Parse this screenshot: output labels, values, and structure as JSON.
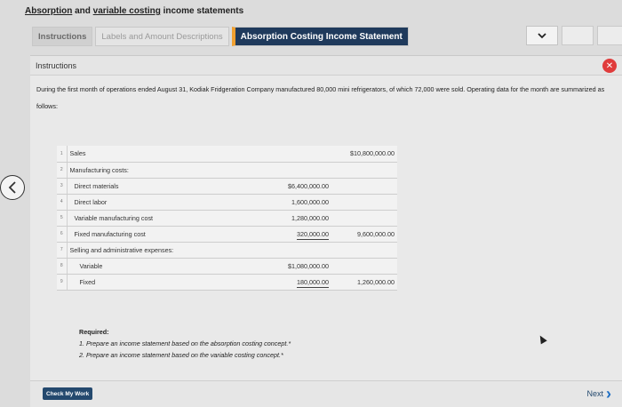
{
  "page": {
    "title_part1": "Absorption",
    "title_part2": " and ",
    "title_part3": "variable costing",
    "title_part4": " income statements"
  },
  "tabs": [
    {
      "label": "Instructions"
    },
    {
      "label": "Labels and Amount Descriptions"
    },
    {
      "label": "Absorption Costing Income Statement"
    }
  ],
  "icons": {
    "chevron": "chevron-down-icon",
    "menu": "menu-icon",
    "close": "close-icon",
    "back": "chevron-left-icon",
    "next": "chevron-right-icon"
  },
  "colors": {
    "active_tab": "#1f3a5c",
    "active_tab_accent": "#f0a030",
    "close_button": "#e03c3c",
    "check_button": "#24496e"
  },
  "panel": {
    "heading": "Instructions",
    "description": "During the first month of operations ended August 31, Kodiak Fridgeration Company manufactured 80,000 mini refrigerators, of which 72,000 were sold. Operating data for the month are summarized as follows:"
  },
  "table": {
    "rows": [
      {
        "num": "1",
        "label": "Sales",
        "c1": "",
        "c2": "$10,800,000.00",
        "indent": 0,
        "ul1": false,
        "ul2": false
      },
      {
        "num": "2",
        "label": "Manufacturing costs:",
        "c1": "",
        "c2": "",
        "indent": 0,
        "ul1": false,
        "ul2": false
      },
      {
        "num": "3",
        "label": "Direct materials",
        "c1": "$6,400,000.00",
        "c2": "",
        "indent": 1,
        "ul1": false,
        "ul2": false
      },
      {
        "num": "4",
        "label": "Direct labor",
        "c1": "1,600,000.00",
        "c2": "",
        "indent": 1,
        "ul1": false,
        "ul2": false
      },
      {
        "num": "5",
        "label": "Variable manufacturing cost",
        "c1": "1,280,000.00",
        "c2": "",
        "indent": 1,
        "ul1": false,
        "ul2": false
      },
      {
        "num": "6",
        "label": "Fixed manufacturing cost",
        "c1": "320,000.00",
        "c2": "9,600,000.00",
        "indent": 1,
        "ul1": true,
        "ul2": false
      },
      {
        "num": "7",
        "label": "Selling and administrative expenses:",
        "c1": "",
        "c2": "",
        "indent": 0,
        "ul1": false,
        "ul2": false
      },
      {
        "num": "8",
        "label": "Variable",
        "c1": "$1,080,000.00",
        "c2": "",
        "indent": 2,
        "ul1": false,
        "ul2": false
      },
      {
        "num": "9",
        "label": "Fixed",
        "c1": "180,000.00",
        "c2": "1,260,000.00",
        "indent": 2,
        "ul1": true,
        "ul2": false
      }
    ]
  },
  "required": {
    "heading": "Required:",
    "item1": "1.  Prepare an income statement based on the absorption costing concept.*",
    "item2": "2.  Prepare an income statement based on the variable costing concept.*"
  },
  "footer": {
    "check_label": "Check My Work",
    "next_label": "Next"
  }
}
